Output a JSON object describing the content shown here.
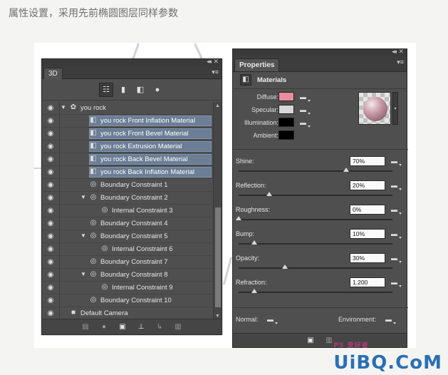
{
  "caption": "属性设置，采用先前椭圆图层同样参数",
  "panel3d": {
    "tab": "3D",
    "tree": [
      {
        "label": "you rock",
        "indent": 0,
        "icon": "scene-icon",
        "toggle": "open",
        "selected": false
      },
      {
        "label": "you rock Front Inflation Material",
        "indent": 1,
        "icon": "material-icon",
        "toggle": "",
        "selected": true
      },
      {
        "label": "you rock Front Bevel Material",
        "indent": 1,
        "icon": "material-icon",
        "toggle": "",
        "selected": true
      },
      {
        "label": "you rock Extrusion Material",
        "indent": 1,
        "icon": "material-icon",
        "toggle": "",
        "selected": true
      },
      {
        "label": "you rock Back Bevel Material",
        "indent": 1,
        "icon": "material-icon",
        "toggle": "",
        "selected": true
      },
      {
        "label": "you rock Back Inflation Material",
        "indent": 1,
        "icon": "material-icon",
        "toggle": "",
        "selected": true
      },
      {
        "label": "Boundary Constraint 1",
        "indent": 1,
        "icon": "constraint-icon",
        "toggle": "",
        "selected": false
      },
      {
        "label": "Boundary Constraint 2",
        "indent": 1,
        "icon": "constraint-icon",
        "toggle": "open",
        "selected": false
      },
      {
        "label": "Internal Constraint 3",
        "indent": 2,
        "icon": "constraint-icon",
        "toggle": "",
        "selected": false
      },
      {
        "label": "Boundary Constraint 4",
        "indent": 1,
        "icon": "constraint-icon",
        "toggle": "",
        "selected": false
      },
      {
        "label": "Boundary Constraint 5",
        "indent": 1,
        "icon": "constraint-icon",
        "toggle": "open",
        "selected": false
      },
      {
        "label": "Internal Constraint 6",
        "indent": 2,
        "icon": "constraint-icon",
        "toggle": "",
        "selected": false
      },
      {
        "label": "Boundary Constraint 7",
        "indent": 1,
        "icon": "constraint-icon",
        "toggle": "",
        "selected": false
      },
      {
        "label": "Boundary Constraint 8",
        "indent": 1,
        "icon": "constraint-icon",
        "toggle": "open",
        "selected": false
      },
      {
        "label": "Internal Constraint 9",
        "indent": 2,
        "icon": "constraint-icon",
        "toggle": "",
        "selected": false
      },
      {
        "label": "Boundary Constraint 10",
        "indent": 1,
        "icon": "constraint-icon",
        "toggle": "",
        "selected": false
      },
      {
        "label": "Default Camera",
        "indent": 0,
        "icon": "camera-icon",
        "toggle": "",
        "selected": false
      }
    ]
  },
  "properties": {
    "tab": "Properties",
    "section": "Materials",
    "colors": [
      {
        "label": "Diffuse:",
        "color": "#e88ca4"
      },
      {
        "label": "Specular:",
        "color": "#d8d8d8"
      },
      {
        "label": "Illumination:",
        "color": "#000000"
      },
      {
        "label": "Ambient:",
        "color": "#000000"
      }
    ],
    "sliders": [
      {
        "label": "Shine:",
        "value": "70%",
        "level": 0.7
      },
      {
        "label": "Reflection:",
        "value": "20%",
        "level": 0.2
      },
      {
        "label": "Roughness:",
        "value": "0%",
        "level": 0.0
      },
      {
        "label": "Bump:",
        "value": "10%",
        "level": 0.1
      },
      {
        "label": "Opacity:",
        "value": "30%",
        "level": 0.3
      },
      {
        "label": "Refraction:",
        "value": "1.200",
        "level": 0.1
      }
    ],
    "normal_label": "Normal:",
    "environment_label": "Environment:"
  },
  "watermark": {
    "main": "UiBQ.CoM",
    "small": "PS 爱好者"
  }
}
